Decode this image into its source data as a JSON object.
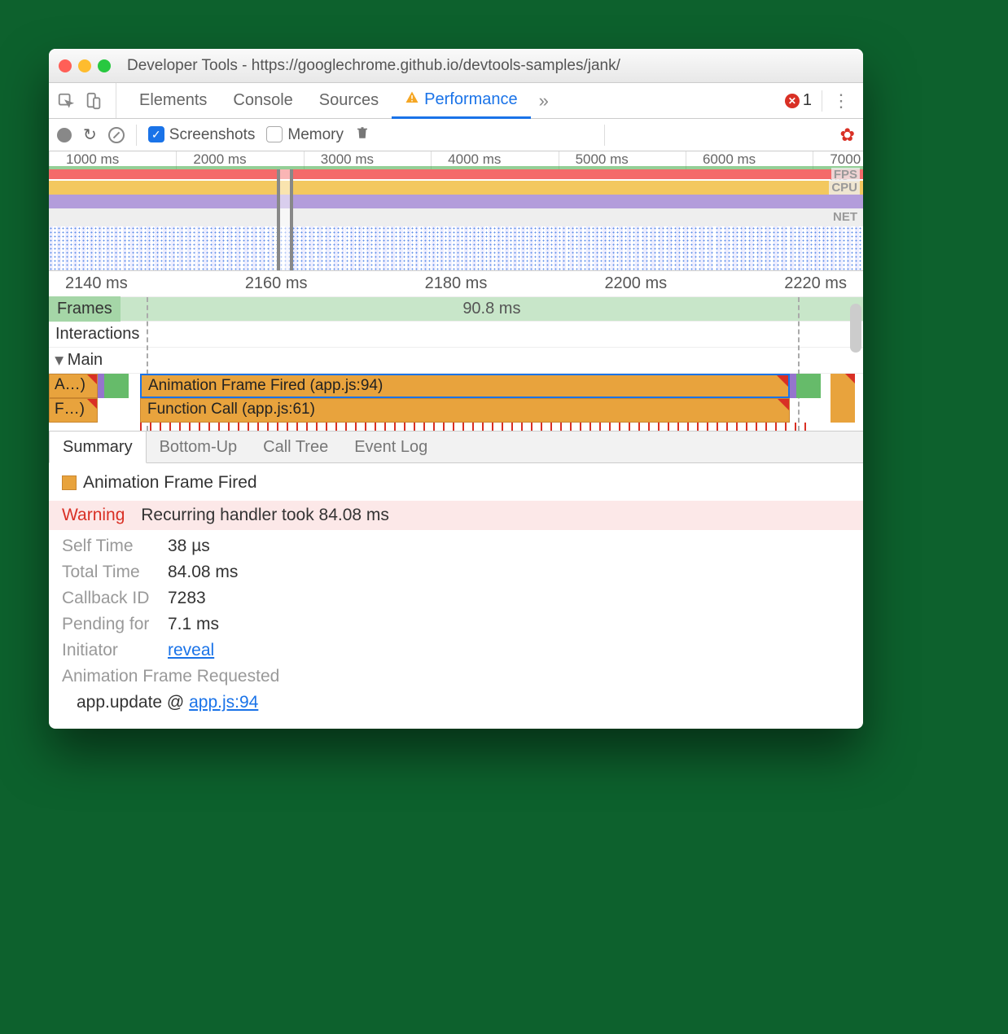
{
  "window": {
    "title": "Developer Tools - https://googlechrome.github.io/devtools-samples/jank/"
  },
  "tabs": {
    "items": [
      "Elements",
      "Console",
      "Sources",
      "Performance"
    ],
    "active": "Performance",
    "overflow": "»",
    "error_count": "1"
  },
  "toolbar": {
    "screenshots": "Screenshots",
    "memory": "Memory"
  },
  "overview": {
    "ticks": [
      "1000 ms",
      "2000 ms",
      "3000 ms",
      "4000 ms",
      "5000 ms",
      "6000 ms",
      "7000 ms"
    ],
    "labels": {
      "fps": "FPS",
      "cpu": "CPU",
      "net": "NET"
    }
  },
  "detail_ruler": [
    "2140 ms",
    "2160 ms",
    "2180 ms",
    "2200 ms",
    "2220 ms"
  ],
  "tracks": {
    "frames": "Frames",
    "frame_duration": "90.8 ms",
    "interactions": "Interactions",
    "main": "Main",
    "flame1_left": "A…)",
    "flame1_main": "Animation Frame Fired (app.js:94)",
    "flame2_left": "F…)",
    "flame2_main": "Function Call (app.js:61)"
  },
  "bottom_tabs": [
    "Summary",
    "Bottom-Up",
    "Call Tree",
    "Event Log"
  ],
  "summary": {
    "title": "Animation Frame Fired",
    "warning_label": "Warning",
    "warning_text": "Recurring handler took 84.08 ms",
    "self_time_k": "Self Time",
    "self_time_v": "38 µs",
    "total_time_k": "Total Time",
    "total_time_v": "84.08 ms",
    "callback_k": "Callback ID",
    "callback_v": "7283",
    "pending_k": "Pending for",
    "pending_v": "7.1 ms",
    "initiator_k": "Initiator",
    "initiator_v": "reveal",
    "requested": "Animation Frame Requested",
    "stack_fn": "app.update @ ",
    "stack_link": "app.js:94"
  }
}
